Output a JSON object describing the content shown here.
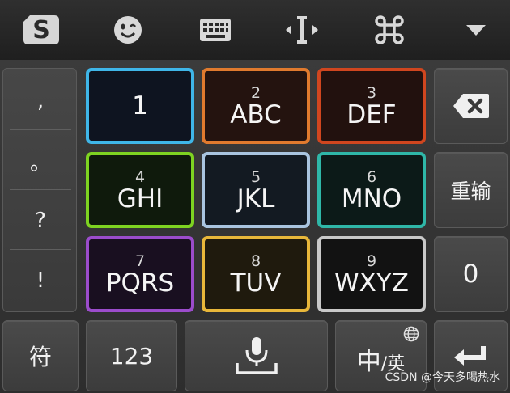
{
  "toolbar": {
    "logo_letter": "S",
    "items": [
      "sogou-logo",
      "emoji",
      "keyboard",
      "cursor-move",
      "command",
      "collapse"
    ]
  },
  "punctuation": [
    ",",
    "。",
    "?",
    "!"
  ],
  "keys": {
    "k1": {
      "digit": "",
      "letters": "1",
      "color": "#3fb6e8"
    },
    "k2": {
      "digit": "2",
      "letters": "ABC",
      "color": "#e07a2e"
    },
    "k3": {
      "digit": "3",
      "letters": "DEF",
      "color": "#d0461f"
    },
    "k4": {
      "digit": "4",
      "letters": "GHI",
      "color": "#7ed321"
    },
    "k5": {
      "digit": "5",
      "letters": "JKL",
      "color": "#a9c4df"
    },
    "k6": {
      "digit": "6",
      "letters": "MNO",
      "color": "#2fb7a8"
    },
    "k7": {
      "digit": "7",
      "letters": "PQRS",
      "color": "#9b4ccb"
    },
    "k8": {
      "digit": "8",
      "letters": "TUV",
      "color": "#e8b73a"
    },
    "k9": {
      "digit": "9",
      "letters": "WXYZ",
      "color": "#c9c9c9"
    }
  },
  "right": {
    "retype_label": "重输",
    "zero_label": "0"
  },
  "bottom": {
    "symbol_label": "符",
    "num_label": "123",
    "lang_main": "中",
    "lang_sep": "/",
    "lang_sub": "英"
  },
  "watermark": "CSDN @今天多喝热水"
}
